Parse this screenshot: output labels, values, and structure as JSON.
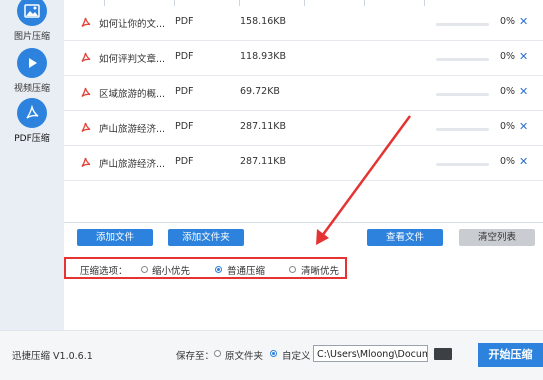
{
  "sidebar": {
    "items": [
      {
        "label": "图片压缩",
        "icon": "image-icon"
      },
      {
        "label": "视频压缩",
        "icon": "play-icon"
      },
      {
        "label": "PDF压缩",
        "icon": "pdf-icon"
      }
    ]
  },
  "files": [
    {
      "name": "如何让你的文...",
      "type": "PDF",
      "size": "158.16KB",
      "progress": 0,
      "percent": "0%",
      "remove": "✕"
    },
    {
      "name": "如何评判文章...",
      "type": "PDF",
      "size": "118.93KB",
      "progress": 0,
      "percent": "0%",
      "remove": "✕"
    },
    {
      "name": "区域旅游的概...",
      "type": "PDF",
      "size": "69.72KB",
      "progress": 0,
      "percent": "0%",
      "remove": "✕"
    },
    {
      "name": "庐山旅游经济...",
      "type": "PDF",
      "size": "287.11KB",
      "progress": 0,
      "percent": "0%",
      "remove": "✕"
    },
    {
      "name": "庐山旅游经济...",
      "type": "PDF",
      "size": "287.11KB",
      "progress": 0,
      "percent": "0%",
      "remove": "✕"
    }
  ],
  "buttons": {
    "add_file": "添加文件",
    "add_folder": "添加文件夹",
    "view_file": "查看文件",
    "clear_list": "清空列表"
  },
  "compress_options": {
    "label": "压缩选项：",
    "options": [
      "缩小优先",
      "普通压缩",
      "清晰优先"
    ],
    "selected": "普通压缩"
  },
  "footer": {
    "version": "迅捷压缩 V1.0.6.1",
    "save_to_label": "保存至：",
    "save_options": [
      "原文件夹",
      "自定义"
    ],
    "save_selected": "自定义",
    "path": "C:\\Users\\Mloong\\Docume",
    "start_button": "开始压缩"
  },
  "colors": {
    "accent": "#2c82dd",
    "highlight_border": "#e53333",
    "pdf_red": "#e0443a"
  }
}
